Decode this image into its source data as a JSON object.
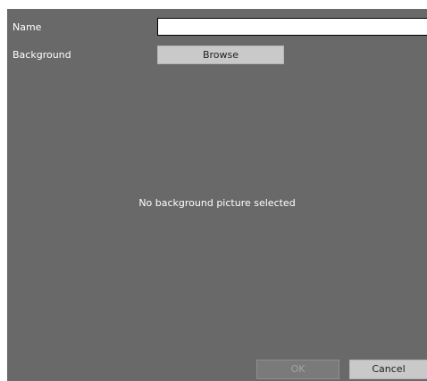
{
  "form": {
    "name_label": "Name",
    "name_value": "",
    "background_label": "Background",
    "browse_label": "Browse"
  },
  "preview": {
    "empty_message": "No background picture selected"
  },
  "footer": {
    "ok_label": "OK",
    "ok_enabled": false,
    "cancel_label": "Cancel"
  },
  "colors": {
    "panel_background": "#696969",
    "button_background": "#c9c9c9",
    "disabled_button_background": "#7a7a7a"
  }
}
